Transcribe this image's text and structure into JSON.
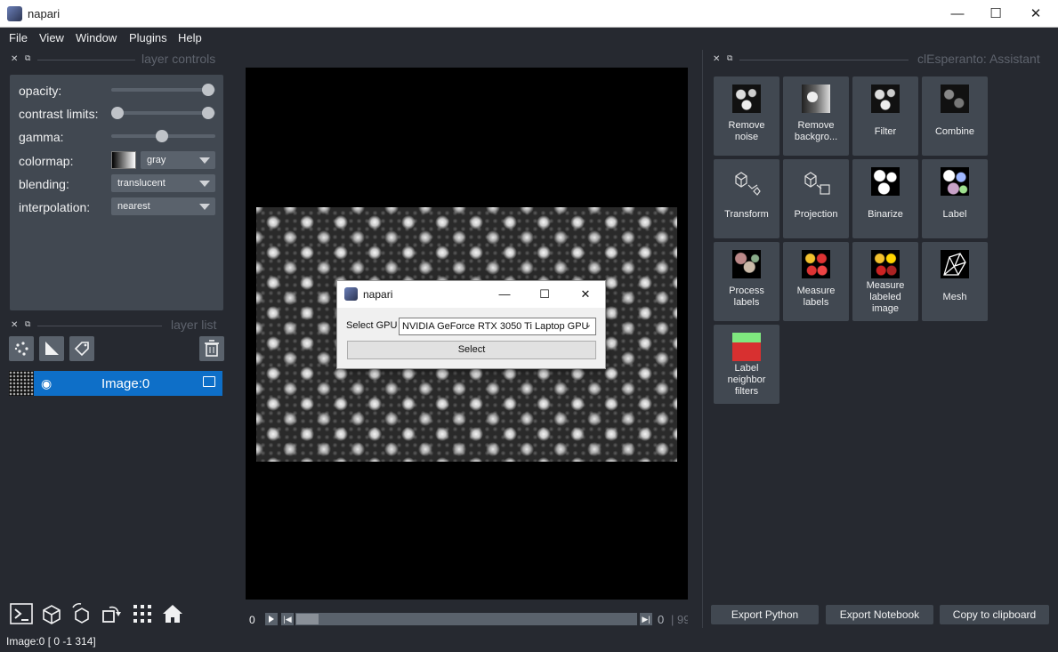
{
  "window": {
    "title": "napari",
    "minimize": "—",
    "maximize": "☐",
    "close": "✕"
  },
  "menu": [
    "File",
    "View",
    "Window",
    "Plugins",
    "Help"
  ],
  "layer_controls": {
    "header": "layer controls",
    "opacity_label": "opacity:",
    "opacity_value": 1.0,
    "contrast_label": "contrast limits:",
    "gamma_label": "gamma:",
    "colormap_label": "colormap:",
    "colormap_value": "gray",
    "blending_label": "blending:",
    "blending_value": "translucent",
    "interpolation_label": "interpolation:",
    "interpolation_value": "nearest"
  },
  "layer_list": {
    "header": "layer list",
    "layers": [
      {
        "name": "Image:0",
        "visible": true
      }
    ]
  },
  "status": "Image:0 [  0  -1 314]",
  "playback": {
    "current_left": "0",
    "current_right": "0",
    "sep": "|",
    "max": "99"
  },
  "dialog": {
    "title": "napari",
    "minimize": "—",
    "maximize": "☐",
    "close": "✕",
    "gpu_label": "Select GPU",
    "gpu_value": "NVIDIA GeForce RTX 3050 Ti Laptop GPU",
    "select_label": "Select"
  },
  "assistant": {
    "header": "clEsperanto: Assistant",
    "tiles": [
      {
        "label": "Remove noise",
        "line1": "Remove",
        "line2": "noise",
        "line3": ""
      },
      {
        "label": "Remove backgro...",
        "line1": "Remove",
        "line2": "backgro...",
        "line3": ""
      },
      {
        "label": "Filter",
        "line1": "Filter",
        "line2": "",
        "line3": ""
      },
      {
        "label": "Combine",
        "line1": "Combine",
        "line2": "",
        "line3": ""
      },
      {
        "label": "Transform",
        "line1": "Transform",
        "line2": "",
        "line3": ""
      },
      {
        "label": "Projection",
        "line1": "Projection",
        "line2": "",
        "line3": ""
      },
      {
        "label": "Binarize",
        "line1": "Binarize",
        "line2": "",
        "line3": ""
      },
      {
        "label": "Label",
        "line1": "Label",
        "line2": "",
        "line3": ""
      },
      {
        "label": "Process labels",
        "line1": "Process",
        "line2": "labels",
        "line3": ""
      },
      {
        "label": "Measure labels",
        "line1": "Measure",
        "line2": "labels",
        "line3": ""
      },
      {
        "label": "Measure labeled image",
        "line1": "Measure",
        "line2": "labeled",
        "line3": "image"
      },
      {
        "label": "Mesh",
        "line1": "Mesh",
        "line2": "",
        "line3": ""
      },
      {
        "label": "Label neighbor filters",
        "line1": "Label",
        "line2": "neighbor",
        "line3": "filters"
      }
    ],
    "export_python": "Export Python",
    "export_notebook": "Export Notebook",
    "copy_clipboard": "Copy to clipboard"
  }
}
